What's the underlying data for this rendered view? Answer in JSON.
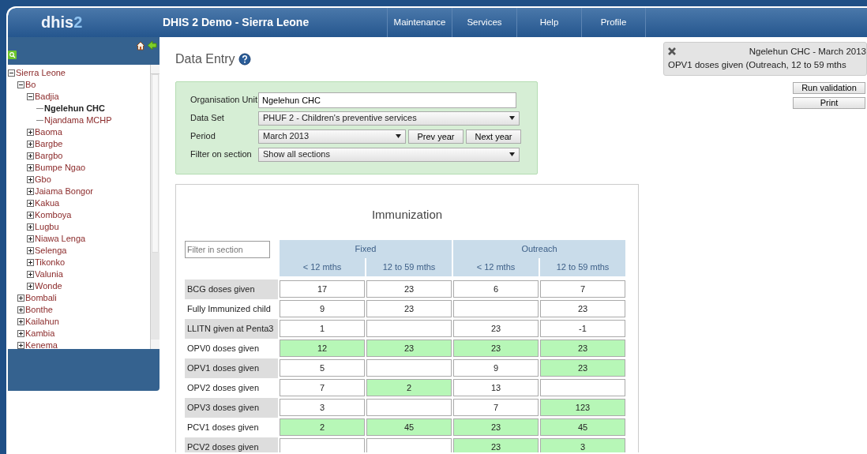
{
  "header": {
    "logo": {
      "main": "dhis",
      "accent": "2"
    },
    "title": "DHIS 2 Demo - Sierra Leone",
    "menu": [
      "Maintenance",
      "Services",
      "Help",
      "Profile"
    ]
  },
  "tree": [
    {
      "label": "Sierra Leone",
      "selected": false,
      "expanded": true,
      "children": [
        {
          "label": "Bo",
          "selected": false,
          "expanded": true,
          "children": [
            {
              "label": "Badjia",
              "selected": false,
              "expanded": true,
              "children": [
                {
                  "label": "Ngelehun CHC",
                  "selected": true
                },
                {
                  "label": "Njandama MCHP",
                  "selected": false
                }
              ]
            },
            {
              "label": "Baoma",
              "selected": false,
              "expanded": false
            },
            {
              "label": "Bargbe",
              "selected": false,
              "expanded": false
            },
            {
              "label": "Bargbo",
              "selected": false,
              "expanded": false
            },
            {
              "label": "Bumpe Ngao",
              "selected": false,
              "expanded": false
            },
            {
              "label": "Gbo",
              "selected": false,
              "expanded": false
            },
            {
              "label": "Jaiama Bongor",
              "selected": false,
              "expanded": false
            },
            {
              "label": "Kakua",
              "selected": false,
              "expanded": false
            },
            {
              "label": "Komboya",
              "selected": false,
              "expanded": false
            },
            {
              "label": "Lugbu",
              "selected": false,
              "expanded": false
            },
            {
              "label": "Niawa Lenga",
              "selected": false,
              "expanded": false
            },
            {
              "label": "Selenga",
              "selected": false,
              "expanded": false
            },
            {
              "label": "Tikonko",
              "selected": false,
              "expanded": false
            },
            {
              "label": "Valunia",
              "selected": false,
              "expanded": false
            },
            {
              "label": "Wonde",
              "selected": false,
              "expanded": false
            }
          ]
        },
        {
          "label": "Bombali",
          "selected": false,
          "expanded": false
        },
        {
          "label": "Bonthe",
          "selected": false,
          "expanded": false
        },
        {
          "label": "Kailahun",
          "selected": false,
          "expanded": false
        },
        {
          "label": "Kambia",
          "selected": false,
          "expanded": false
        },
        {
          "label": "Kenema",
          "selected": false,
          "expanded": false
        }
      ]
    }
  ],
  "page_title": "Data Entry",
  "form": {
    "org_unit_label": "Organisation Unit",
    "org_unit": "Ngelehun CHC",
    "data_set_label": "Data Set",
    "data_set": "PHUF 2 - Children's preventive services",
    "period_label": "Period",
    "period": "March 2013",
    "prev_button": "Prev year",
    "next_button": "Next year",
    "section_label": "Filter on section",
    "section": "Show all sections"
  },
  "section": {
    "title": "Immunization",
    "filter_placeholder": "Filter in section",
    "groups": [
      "Fixed",
      "Outreach"
    ],
    "columns": [
      "< 12 mths",
      "12 to 59 mths",
      "< 12 mths",
      "12 to 59 mths"
    ],
    "rows": [
      {
        "label": "BCG doses given",
        "cells": [
          {
            "value": "17",
            "saved": false
          },
          {
            "value": "23",
            "saved": false
          },
          {
            "value": "6",
            "saved": false
          },
          {
            "value": "7",
            "saved": false
          }
        ]
      },
      {
        "label": "Fully Immunized child",
        "cells": [
          {
            "value": "9",
            "saved": false
          },
          {
            "value": "23",
            "saved": false
          },
          {
            "saved": false
          },
          {
            "value": "23",
            "saved": false
          }
        ]
      },
      {
        "label": "LLITN given at Penta3",
        "cells": [
          {
            "value": "1",
            "saved": false
          },
          {
            "saved": false
          },
          {
            "value": "23",
            "saved": false
          },
          {
            "value": "-1",
            "saved": false
          }
        ]
      },
      {
        "label": "OPV0 doses given",
        "cells": [
          {
            "value": "12",
            "saved": true
          },
          {
            "value": "23",
            "saved": true
          },
          {
            "value": "23",
            "saved": true
          },
          {
            "value": "23",
            "saved": true
          }
        ]
      },
      {
        "label": "OPV1 doses given",
        "cells": [
          {
            "value": "5",
            "saved": false
          },
          {
            "saved": false
          },
          {
            "value": "9",
            "saved": false
          },
          {
            "value": "23",
            "saved": true
          }
        ]
      },
      {
        "label": "OPV2 doses given",
        "cells": [
          {
            "value": "7",
            "saved": false
          },
          {
            "value": "2",
            "saved": true
          },
          {
            "value": "13",
            "saved": false
          },
          {
            "saved": false
          }
        ]
      },
      {
        "label": "OPV3 doses given",
        "cells": [
          {
            "value": "3",
            "saved": false
          },
          {
            "saved": false
          },
          {
            "value": "7",
            "saved": false
          },
          {
            "value": "123",
            "saved": true
          }
        ]
      },
      {
        "label": "PCV1 doses given",
        "cells": [
          {
            "value": "2",
            "saved": true
          },
          {
            "value": "45",
            "saved": true
          },
          {
            "value": "23",
            "saved": true
          },
          {
            "value": "45",
            "saved": true
          }
        ]
      },
      {
        "label": "PCV2 doses given",
        "cells": [
          {
            "saved": false
          },
          {
            "saved": false
          },
          {
            "value": "23",
            "saved": true
          },
          {
            "value": "3",
            "saved": true
          }
        ]
      }
    ]
  },
  "info_box": {
    "line_1": "Ngelehun CHC - March 2013",
    "line_2": "OPV1 doses given (Outreach, 12 to 59 mths"
  },
  "actions": [
    "Run validation",
    "Print"
  ]
}
